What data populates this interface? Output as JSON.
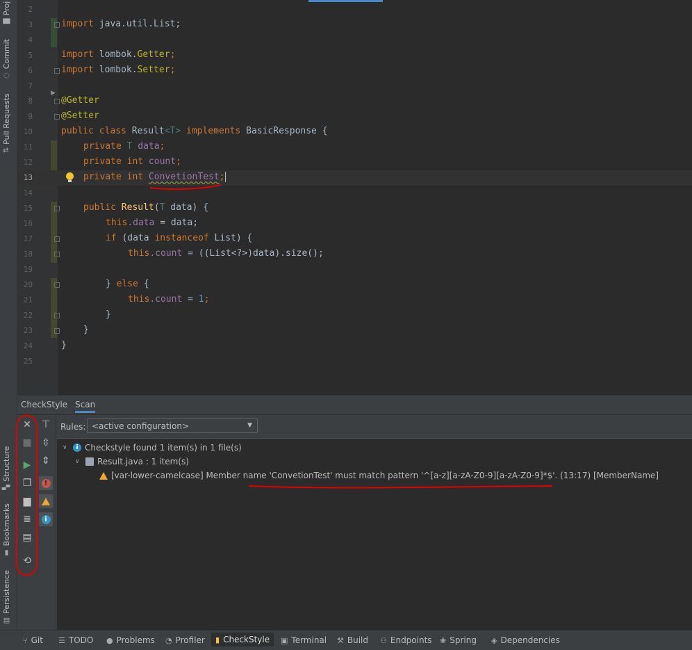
{
  "left_strip": {
    "tabs": [
      "Proj",
      "Commit",
      "Pull Requests",
      "Structure",
      "Bookmarks",
      "Persistence"
    ]
  },
  "editor": {
    "lines": [
      {
        "n": "2"
      },
      {
        "n": "3"
      },
      {
        "n": "4"
      },
      {
        "n": "5"
      },
      {
        "n": "6"
      },
      {
        "n": "7"
      },
      {
        "n": "8"
      },
      {
        "n": "9"
      },
      {
        "n": "10"
      },
      {
        "n": "11"
      },
      {
        "n": "12"
      },
      {
        "n": "13"
      },
      {
        "n": "14"
      },
      {
        "n": "15"
      },
      {
        "n": "16"
      },
      {
        "n": "17"
      },
      {
        "n": "18"
      },
      {
        "n": "19"
      },
      {
        "n": "20"
      },
      {
        "n": "21"
      },
      {
        "n": "22"
      },
      {
        "n": "23"
      },
      {
        "n": "24"
      },
      {
        "n": "25"
      }
    ],
    "code": {
      "l3": {
        "kw": "import",
        "rest": " java.util.List;"
      },
      "l5": {
        "kw": "import",
        "pkg": " lombok.",
        "cls": "Getter",
        "end": ";"
      },
      "l6": {
        "kw": "import",
        "pkg": " lombok.",
        "cls": "Setter",
        "end": ";"
      },
      "l8": "@Getter",
      "l9": "@Setter",
      "l10": {
        "kw1": "public class",
        "name": " Result",
        "tp": "<T>",
        "kw2": " implements",
        "rest": " BasicResponse {"
      },
      "l11": {
        "kw": "private",
        "type": " T",
        "field": " data",
        "end": ";"
      },
      "l12": {
        "kw": "private int",
        "field": " count",
        "end": ";"
      },
      "l13": {
        "kw": "private int",
        "field": "ConvetionTest",
        "end": ";"
      },
      "l15": {
        "kw": "public",
        "name": " Result",
        "open": "(",
        "tp": "T",
        "rest": " data) {"
      },
      "l16": {
        "kw": "this",
        "field": ".data",
        "rest": " = data;"
      },
      "l17": {
        "kw": "if",
        "mid": " (data ",
        "kw2": "instanceof",
        "rest": " List) {"
      },
      "l18": {
        "kw": "this",
        "field": ".count",
        "rest": " = ((List<?>)data).size();"
      },
      "l20": {
        "pre": "} ",
        "kw": "else",
        "rest": " {"
      },
      "l21": {
        "kw": "this",
        "field": ".count",
        "mid": " = ",
        "num": "1",
        "end": ";"
      },
      "l22": "}",
      "l23": "}",
      "l24": "}"
    }
  },
  "panel": {
    "tabs": [
      "CheckStyle",
      "Scan"
    ],
    "selected_tab": "Scan",
    "rules_label": "Rules:",
    "rules_value": "<active configuration>",
    "results": {
      "summary": "Checkstyle found 1 item(s) in 1 file(s)",
      "file": "Result.java : 1 item(s)",
      "issue": "[var-lower-camelcase] Member name 'ConvetionTest' must match pattern '^[a-z][a-zA-Z0-9][a-zA-Z0-9]*$'. (13:17) [MemberName]"
    }
  },
  "statusbar": {
    "items": [
      "Git",
      "TODO",
      "Problems",
      "Profiler",
      "CheckStyle",
      "Terminal",
      "Build",
      "Endpoints",
      "Spring",
      "Dependencies"
    ],
    "selected": "CheckStyle"
  },
  "colors": {
    "editor_bg": "#2b2b2b",
    "keyword": "#cc7832",
    "annotation": "#bbb529",
    "field": "#9876aa",
    "number": "#6897bb",
    "accent": "#4a88c7",
    "marker_red": "#e00000"
  }
}
